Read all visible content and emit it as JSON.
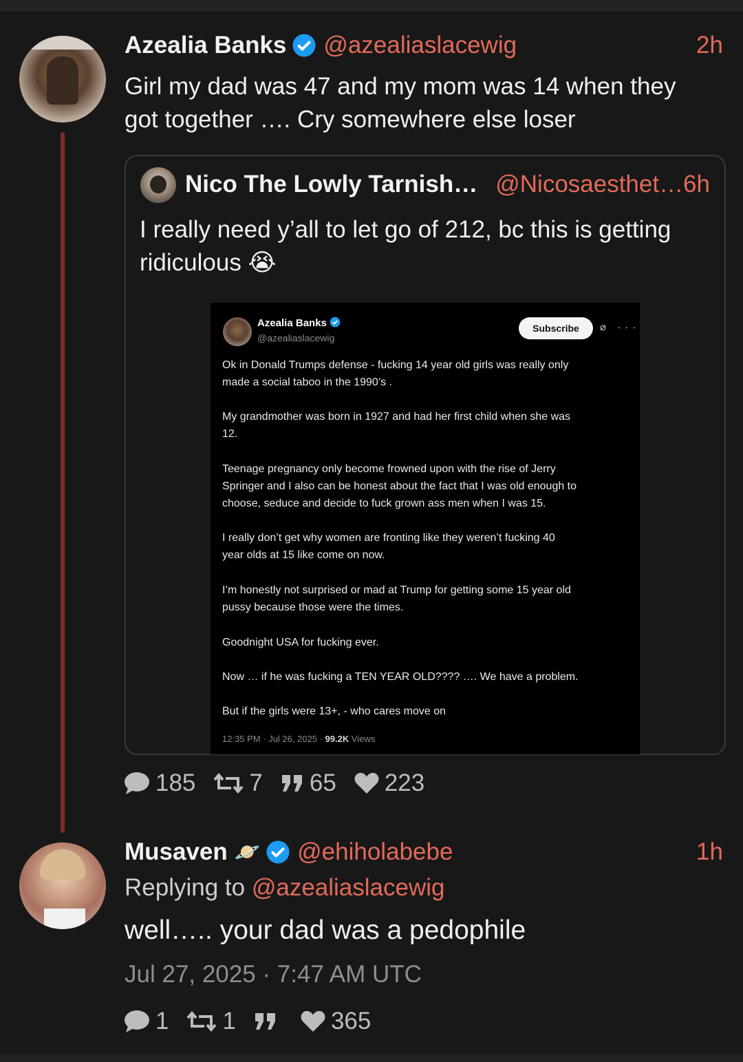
{
  "post": {
    "name": "Azealia Banks",
    "handle": "@azealiaslacewig",
    "time": "2h",
    "text_line1": "Girl my dad was 47 and my mom was 14 when they",
    "text_line2": "got together …. Cry somewhere else loser",
    "stats": {
      "replies": "185",
      "retweets": "7",
      "quotes": "65",
      "likes": "223"
    }
  },
  "quote": {
    "name": "Nico The Lowly Tarnish…",
    "handle": "@Nicosaesthet…",
    "time": "6h",
    "text_line1": "I really need y’all to let go of 212, bc this is getting",
    "text_line2": "ridiculous 😭"
  },
  "screenshot": {
    "name": "Azealia Banks",
    "handle": "@azealiaslacewig",
    "subscribe_label": "Subscribe",
    "icons": "⌀ ···",
    "paragraphs": [
      {
        "l1": "Ok in Donald Trumps defense - fucking 14 year old girls was really only",
        "l2": "made a social taboo in the 1990’s ."
      },
      {
        "l1": "My grandmother was born in 1927 and had her first child when she was",
        "l2": "12."
      },
      {
        "l1": "Teenage pregnancy only become frowned upon with the rise of Jerry",
        "l2": "Springer and I also can be honest about the fact that I was old enough to",
        "l3": "choose, seduce and decide to fuck grown ass men when I was 15."
      },
      {
        "l1": "I really don’t get why women are fronting like they weren’t fucking 40",
        "l2": "year olds at 15 like come on now."
      },
      {
        "l1": "I’m honestly not surprised or mad at Trump for getting some 15 year old",
        "l2": "pussy because those were the times."
      },
      {
        "l1": "Goodnight USA for fucking ever."
      },
      {
        "l1": "Now … if he was fucking a TEN YEAR OLD???? …. We have a problem."
      },
      {
        "l1": "But if the girls were 13+, - who cares move on"
      }
    ],
    "footer_time": "12:35 PM · Jul 26, 2025 · ",
    "footer_views": "99.2K",
    "footer_views_label": " Views"
  },
  "reply": {
    "name": "Musaven",
    "emoji": "🪐",
    "handle": "@ehiholabebe",
    "time": "1h",
    "replying_prefix": "Replying to ",
    "replying_handle": "@azealiaslacewig",
    "text": "well….. your dad was a pedophile",
    "date": "Jul 27, 2025 · 7:47 AM UTC",
    "stats": {
      "replies": "1",
      "retweets": "1",
      "quotes": "",
      "likes": "365"
    }
  },
  "colors": {
    "accent": "#e36a5a",
    "verified": "#1d9bf0",
    "thread_line": "#7a2e2a"
  }
}
